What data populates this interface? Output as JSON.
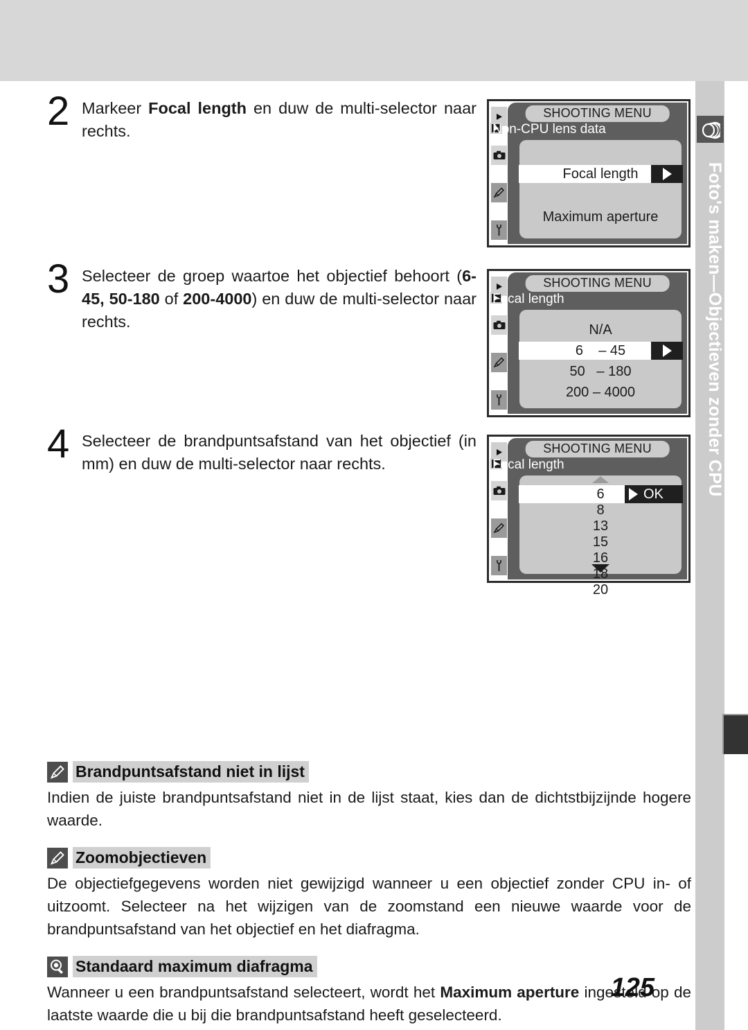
{
  "sidebar": {
    "label": "Foto's maken—Objectieven zonder CPU",
    "icon": "lens-icon"
  },
  "steps": [
    {
      "number": "2",
      "text_parts": [
        {
          "t": "Markeer ",
          "b": false
        },
        {
          "t": "Focal length",
          "b": true
        },
        {
          "t": " en duw de multi-selector naar rechts.",
          "b": false
        }
      ]
    },
    {
      "number": "3",
      "text_parts": [
        {
          "t": "Selecteer de groep waartoe het objectief behoort (",
          "b": false
        },
        {
          "t": "6-45, 50-180",
          "b": true
        },
        {
          "t": " of ",
          "b": false
        },
        {
          "t": "200-4000",
          "b": true
        },
        {
          "t": ") en duw de multi-selector naar rechts.",
          "b": false
        }
      ]
    },
    {
      "number": "4",
      "text_parts": [
        {
          "t": "Selecteer de brandpuntsafstand van het objectief (in mm) en duw de multi-selector naar rechts.",
          "b": false
        }
      ]
    }
  ],
  "lcds": [
    {
      "title": "SHOOTING MENU",
      "subtitle": "Non-CPU lens data",
      "rail_icons": [
        "playback-icon",
        "camera-icon",
        "pencil-icon",
        "wrench-icon"
      ],
      "rows": [
        {
          "label": "Focal length",
          "highlighted": true,
          "arrow": "triangle"
        },
        {
          "label": "Maximum aperture",
          "highlighted": false,
          "arrow": ""
        }
      ],
      "scroll_up": false,
      "scroll_down": false
    },
    {
      "title": "SHOOTING MENU",
      "subtitle": "Focal length",
      "rail_icons": [
        "playback-icon",
        "camera-icon",
        "pencil-icon",
        "wrench-icon"
      ],
      "rows": [
        {
          "label": "N/A",
          "highlighted": false,
          "arrow": ""
        },
        {
          "label": "6    – 45",
          "highlighted": true,
          "arrow": "triangle"
        },
        {
          "label": "50   – 180",
          "highlighted": false,
          "arrow": ""
        },
        {
          "label": "200 – 4000",
          "highlighted": false,
          "arrow": ""
        }
      ],
      "scroll_up": false,
      "scroll_down": false
    },
    {
      "title": "SHOOTING MENU",
      "subtitle": "Focal length",
      "rail_icons": [
        "playback-icon",
        "camera-icon",
        "pencil-icon",
        "wrench-icon"
      ],
      "rows": [
        {
          "label": "6",
          "highlighted": true,
          "arrow": "triangle-ok",
          "ok": "OK"
        },
        {
          "label": "8",
          "highlighted": false,
          "arrow": ""
        },
        {
          "label": "13",
          "highlighted": false,
          "arrow": ""
        },
        {
          "label": "15",
          "highlighted": false,
          "arrow": ""
        },
        {
          "label": "16",
          "highlighted": false,
          "arrow": ""
        },
        {
          "label": "18",
          "highlighted": false,
          "arrow": ""
        },
        {
          "label": "20",
          "highlighted": false,
          "arrow": ""
        }
      ],
      "scroll_up": true,
      "scroll_down": true
    }
  ],
  "notes": [
    {
      "icon": "pencil-note-icon",
      "title": "Brandpuntsafstand niet in lijst",
      "text_parts": [
        {
          "t": "Indien de juiste brandpuntsafstand niet in de lijst staat, kies dan de dichtstbijzijnde hogere waarde.",
          "b": false
        }
      ]
    },
    {
      "icon": "pencil-note-icon",
      "title": "Zoomobjectieven",
      "text_parts": [
        {
          "t": "De objectiefgegevens worden niet gewijzigd wanneer u een objectief zonder CPU in- of uitzoomt. Selecteer na het wijzigen van de zoomstand een nieuwe waarde voor de brandpuntsafstand van het objectief en het diafragma.",
          "b": false
        }
      ]
    },
    {
      "icon": "tip-bulb-icon",
      "title": "Standaard maximum diafragma",
      "text_parts": [
        {
          "t": "Wanneer u een brandpuntsafstand selecteert, wordt het ",
          "b": false
        },
        {
          "t": "Maximum aperture",
          "b": true
        },
        {
          "t": " ingesteld op de laatste waarde die u bij die brandpuntsafstand heeft geselecteerd.",
          "b": false
        }
      ]
    }
  ],
  "page_number": "125",
  "colors": {
    "band": "#d7d7d7",
    "sidebar": "#cccccc",
    "lcd_chrome": "#5e5e5e",
    "lcd_panel": "#c9c9c9",
    "highlight": "#ffffff",
    "note_title_bg": "#d0d0d0"
  }
}
